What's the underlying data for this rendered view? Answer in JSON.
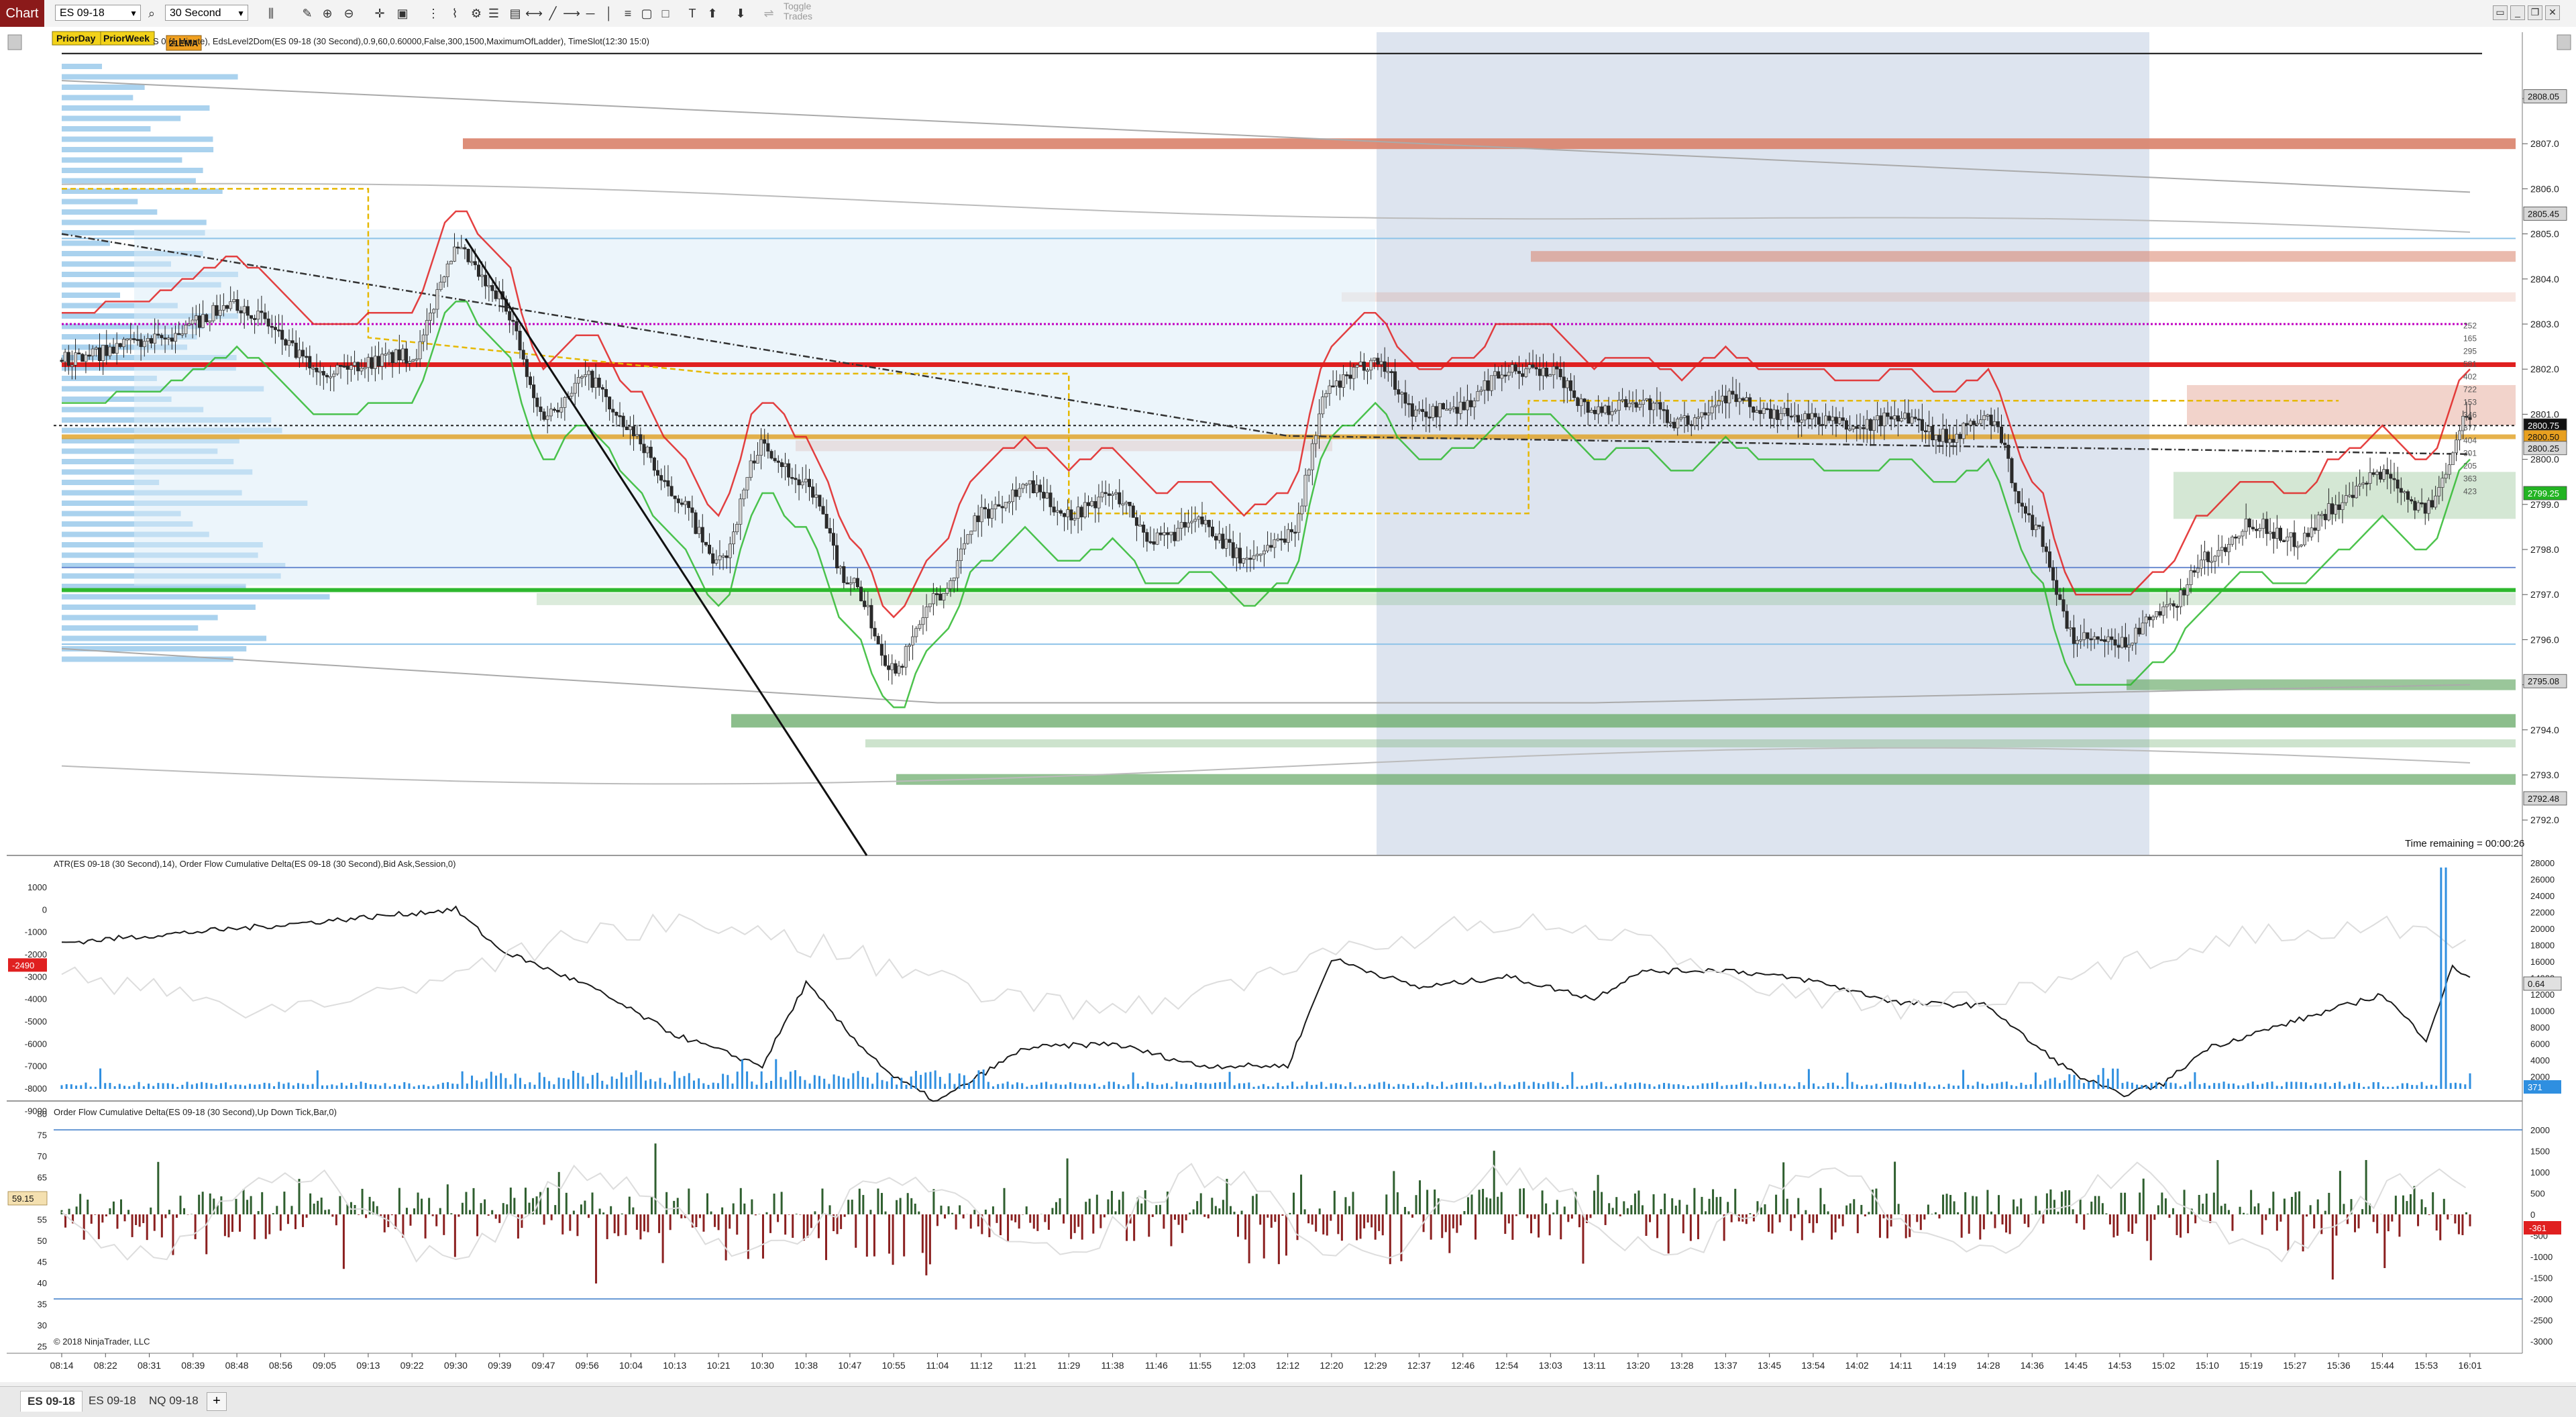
{
  "toolbar": {
    "chart_label": "Chart",
    "instrument": "ES 09-18",
    "interval": "30 Second",
    "toggle_trades_line1": "Toggle",
    "toggle_trades_line2": "Trades"
  },
  "price_panel": {
    "marker_prior_day": "PriorDay",
    "marker_prior_week": "PriorWeek",
    "marker_ema": "21EMA",
    "indicator_text": "S 0 (1 Minute), EdsLevel2Dom(ES 09-18 (30 Second),0.9,60,0.60000,False,300,1500,MaximumOfLadder), TimeSlot(12:30  15:0)",
    "time_remaining": "Time remaining = 00:00:26",
    "price_ticks": [
      "2808.0",
      "2807.0",
      "2806.0",
      "2805.0",
      "2804.0",
      "2803.0",
      "2802.0",
      "2801.0",
      "2800.0",
      "2799.0",
      "2798.0",
      "2797.0",
      "2796.0",
      "2795.0",
      "2794.0",
      "2793.0",
      "2792.0"
    ],
    "price_tags": [
      {
        "text": "2808.05",
        "kind": "gray",
        "price": 2808.05
      },
      {
        "text": "2805.45",
        "kind": "gray",
        "price": 2805.45
      },
      {
        "text": "2800.75",
        "kind": "black",
        "price": 2800.75
      },
      {
        "text": "2800.50",
        "kind": "orange",
        "price": 2800.5
      },
      {
        "text": "2800.25",
        "kind": "gray",
        "price": 2800.25
      },
      {
        "text": "2799.25",
        "kind": "green",
        "price": 2799.25
      },
      {
        "text": "2795.08",
        "kind": "gray",
        "price": 2795.08
      },
      {
        "text": "2792.48",
        "kind": "gray",
        "price": 2792.48
      }
    ],
    "ladder_labels": [
      "252",
      "165",
      "295",
      "581",
      "402",
      "722",
      "153",
      "346",
      "377",
      "404",
      "301",
      "205",
      "363",
      "423"
    ],
    "colors": {
      "session_shade": "#dde4ef",
      "resistance": "#e02020",
      "support": "#2eb82e",
      "orange_level": "#e0a020",
      "magenta_level": "#c000c0",
      "bid_ladder": "#8ec3e8",
      "ask_heat": "#d9826a",
      "bid_heat": "#6fae6f",
      "bull_candle": "#d0d0d0",
      "bear_candle": "#2b2b2b"
    }
  },
  "delta_panel": {
    "indicator_text": "ATR(ES 09-18 (30 Second),14), Order Flow Cumulative Delta(ES 09-18 (30 Second),Bid Ask,Session,0)",
    "left_ticks": [
      "1000",
      "0",
      "-1000",
      "-2000",
      "-3000",
      "-4000",
      "-5000",
      "-6000",
      "-7000",
      "-8000",
      "-9000"
    ],
    "right_ticks": [
      "28000",
      "26000",
      "24000",
      "22000",
      "20000",
      "18000",
      "16000",
      "14000",
      "12000",
      "10000",
      "8000",
      "6000",
      "4000",
      "2000"
    ],
    "left_tag": "-2490",
    "right_tag_value": "0.64",
    "right_tag_volume": "371",
    "colors": {
      "delta_line": "#1a1a1a",
      "volume": "#2f8fe0",
      "tag_red": "#e02020"
    }
  },
  "tick_panel": {
    "indicator_text": "Order Flow Cumulative Delta(ES 09-18 (30 Second),Up Down Tick,Bar,0)",
    "copyright": "© 2018 NinjaTrader, LLC",
    "left_ticks": [
      "80",
      "75",
      "70",
      "65",
      "60",
      "55",
      "50",
      "45",
      "40",
      "35",
      "30",
      "25"
    ],
    "right_ticks": [
      "2000",
      "1500",
      "1000",
      "500",
      "0",
      "-500",
      "-1000",
      "-1500",
      "-2000",
      "-2500",
      "-3000"
    ],
    "left_tag": "59.15",
    "right_tag": "-361",
    "colors": {
      "pos_bar": "#2f5f2f",
      "neg_bar": "#8b2020"
    }
  },
  "time_axis": [
    "08:14",
    "08:22",
    "08:31",
    "08:39",
    "08:48",
    "08:56",
    "09:05",
    "09:13",
    "09:22",
    "09:30",
    "09:39",
    "09:47",
    "09:56",
    "10:04",
    "10:13",
    "10:21",
    "10:30",
    "10:38",
    "10:47",
    "10:55",
    "11:04",
    "11:12",
    "11:21",
    "11:29",
    "11:38",
    "11:46",
    "11:55",
    "12:03",
    "12:12",
    "12:20",
    "12:29",
    "12:37",
    "12:46",
    "12:54",
    "13:03",
    "13:11",
    "13:20",
    "13:28",
    "13:37",
    "13:45",
    "13:54",
    "14:02",
    "14:11",
    "14:19",
    "14:28",
    "14:36",
    "14:45",
    "14:53",
    "15:02",
    "15:10",
    "15:19",
    "15:27",
    "15:36",
    "15:44",
    "15:53",
    "16:01"
  ],
  "tabs": [
    {
      "label": "ES 09-18",
      "active": true
    },
    {
      "label": "ES 09-18",
      "active": false
    },
    {
      "label": "NQ 09-18",
      "active": false
    }
  ],
  "add_tab_label": "+"
}
